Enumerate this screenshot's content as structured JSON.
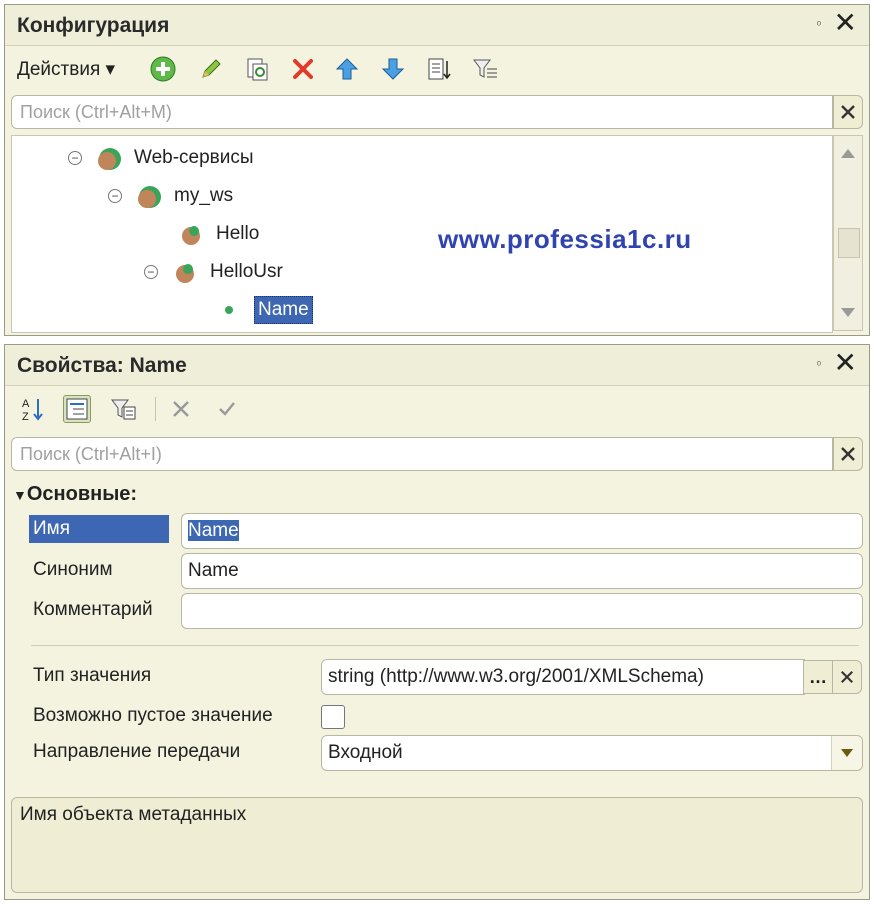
{
  "config_panel": {
    "title": "Конфигурация",
    "pin": "ᵒ",
    "actions_label": "Действия ▾",
    "search_placeholder": "Поиск (Ctrl+Alt+M)",
    "tree": [
      {
        "label": "Web-сервисы",
        "expanded": true,
        "level": 0
      },
      {
        "label": "my_ws",
        "expanded": true,
        "level": 1
      },
      {
        "label": "Hello",
        "level": 2
      },
      {
        "label": "HelloUsr",
        "expanded": true,
        "level": 2
      },
      {
        "label": "Name",
        "level": 3,
        "selected": true
      }
    ],
    "watermark": "www.professia1c.ru"
  },
  "props_panel": {
    "title": "Свойства: Name",
    "pin": "ᵒ",
    "search_placeholder": "Поиск (Ctrl+Alt+I)",
    "section": "Основные:",
    "fields": {
      "name_label": "Имя",
      "name_value": "Name",
      "synonym_label": "Синоним",
      "synonym_value": "Name",
      "comment_label": "Комментарий",
      "comment_value": "",
      "type_label": "Тип значения",
      "type_value": "string (http://www.w3.org/2001/XMLSchema)",
      "nullable_label": "Возможно пустое значение",
      "direction_label": "Направление передачи",
      "direction_value": "Входной"
    },
    "description": "Имя объекта метаданных"
  },
  "colors": {
    "panel_bg": "#f4f3e0",
    "selection": "#3d66b3",
    "watermark": "#3044b0"
  }
}
